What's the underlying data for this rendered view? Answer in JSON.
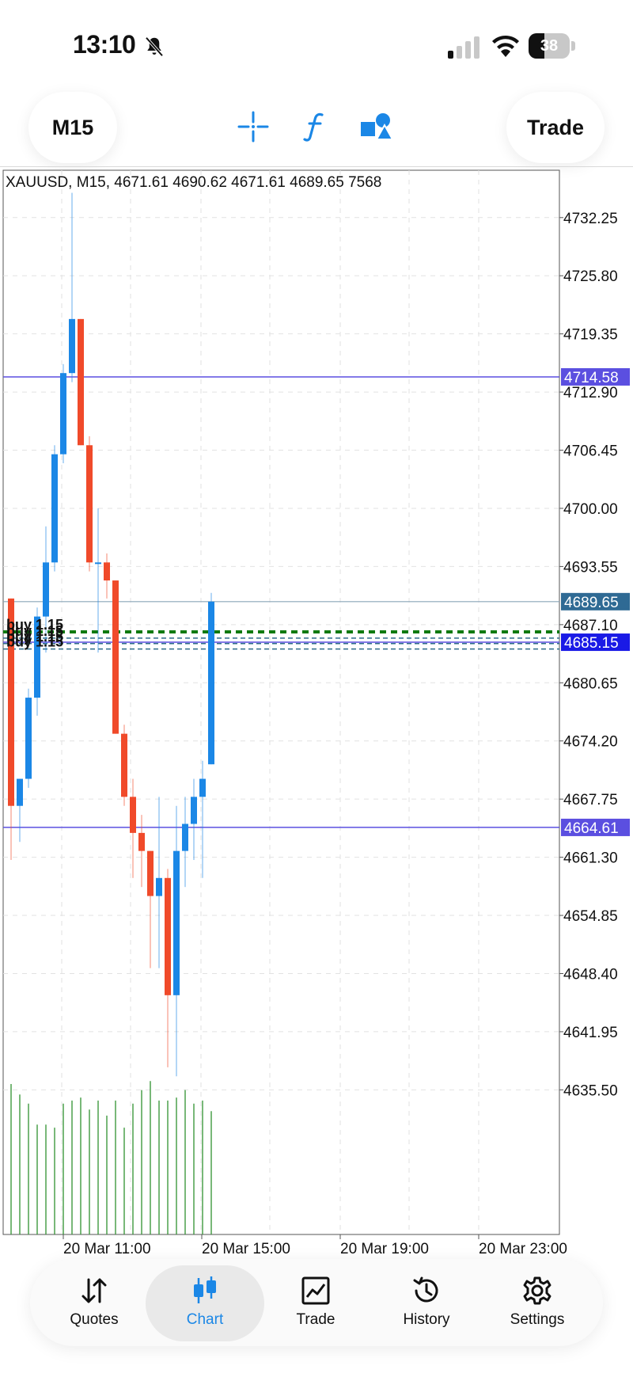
{
  "status": {
    "time": "13:10",
    "battery": "38",
    "battery_level": 0.38,
    "icons": [
      "bell-slash-icon",
      "cellular-signal-icon",
      "wifi-icon",
      "battery-icon"
    ]
  },
  "toolbar": {
    "timeframe": "M15",
    "trade_label": "Trade",
    "icons": [
      "crosshair-icon",
      "indicator-f-icon",
      "objects-shapes-icon"
    ]
  },
  "chart": {
    "header": "XAUUSD, M15, 4671.61 4690.62 4671.61 4689.65 7568",
    "price_labels": [
      "4732.25",
      "4725.80",
      "4719.35",
      "4712.90",
      "4706.45",
      "4700.00",
      "4693.55",
      "4687.10",
      "4680.65",
      "4674.20",
      "4667.75",
      "4661.30",
      "4654.85",
      "4648.40",
      "4641.95",
      "4635.50"
    ],
    "time_labels": [
      "20 Mar 11:00",
      "20 Mar 15:00",
      "20 Mar 19:00",
      "20 Mar 23:00"
    ],
    "price_tags": [
      {
        "value": "4714.58",
        "color": "#5b4fe0"
      },
      {
        "value": "4689.65",
        "color": "#2f6a94"
      },
      {
        "value": "4685.15",
        "color": "#1a1ae6"
      },
      {
        "value": "4664.61",
        "color": "#5b4fe0"
      }
    ],
    "order_labels": [
      "buy 1.15",
      "buy 1.15",
      "buy 1.15",
      "buy 1.15"
    ],
    "colors": {
      "bull": "#1b87e6",
      "bear": "#f04a2a",
      "volume": "#3f9a3f",
      "order_line": "#0f7a0f",
      "level_line": "#5b4fe0"
    }
  },
  "chart_data": {
    "type": "candlestick",
    "symbol": "XAUUSD",
    "timeframe": "M15",
    "y_range": [
      4630,
      4737
    ],
    "levels": [
      4714.58,
      4685.15,
      4664.61
    ],
    "current_price": 4689.65,
    "order_prices": [
      4686.3,
      4685.6,
      4685.0,
      4684.4
    ],
    "candles": [
      {
        "o": 4690,
        "h": 4690,
        "l": 4661,
        "c": 4667
      },
      {
        "o": 4667,
        "h": 4670,
        "l": 4663,
        "c": 4670
      },
      {
        "o": 4670,
        "h": 4680,
        "l": 4669,
        "c": 4679
      },
      {
        "o": 4679,
        "h": 4689,
        "l": 4677,
        "c": 4688
      },
      {
        "o": 4688,
        "h": 4698,
        "l": 4684,
        "c": 4694
      },
      {
        "o": 4694,
        "h": 4707,
        "l": 4693,
        "c": 4706
      },
      {
        "o": 4706,
        "h": 4716,
        "l": 4705,
        "c": 4715
      },
      {
        "o": 4715,
        "h": 4735,
        "l": 4714,
        "c": 4721
      },
      {
        "o": 4721,
        "h": 4721,
        "l": 4707,
        "c": 4707
      },
      {
        "o": 4707,
        "h": 4708,
        "l": 4693,
        "c": 4694
      },
      {
        "o": 4694,
        "h": 4700,
        "l": 4684,
        "c": 4694
      },
      {
        "o": 4694,
        "h": 4695,
        "l": 4690,
        "c": 4692
      },
      {
        "o": 4692,
        "h": 4692,
        "l": 4675,
        "c": 4675
      },
      {
        "o": 4675,
        "h": 4676,
        "l": 4667,
        "c": 4668
      },
      {
        "o": 4668,
        "h": 4670,
        "l": 4659,
        "c": 4664
      },
      {
        "o": 4664,
        "h": 4666,
        "l": 4658,
        "c": 4662
      },
      {
        "o": 4662,
        "h": 4662,
        "l": 4649,
        "c": 4657
      },
      {
        "o": 4657,
        "h": 4668,
        "l": 4649,
        "c": 4659
      },
      {
        "o": 4659,
        "h": 4660,
        "l": 4638,
        "c": 4646
      },
      {
        "o": 4646,
        "h": 4667,
        "l": 4637,
        "c": 4662
      },
      {
        "o": 4662,
        "h": 4668,
        "l": 4658,
        "c": 4665
      },
      {
        "o": 4665,
        "h": 4670,
        "l": 4661,
        "c": 4668
      },
      {
        "o": 4668,
        "h": 4672,
        "l": 4659,
        "c": 4670
      },
      {
        "o": 4671.61,
        "h": 4690.62,
        "l": 4671.61,
        "c": 4689.65
      }
    ],
    "volumes": [
      1.0,
      0.93,
      0.87,
      0.73,
      0.73,
      0.71,
      0.87,
      0.89,
      0.91,
      0.83,
      0.89,
      0.79,
      0.89,
      0.71,
      0.87,
      0.96,
      1.02,
      0.89,
      0.89,
      0.91,
      0.96,
      0.87,
      0.89,
      0.82
    ]
  },
  "nav": {
    "items": [
      {
        "label": "Quotes",
        "name": "nav-quotes",
        "active": false
      },
      {
        "label": "Chart",
        "name": "nav-chart",
        "active": true
      },
      {
        "label": "Trade",
        "name": "nav-trade",
        "active": false
      },
      {
        "label": "History",
        "name": "nav-history",
        "active": false
      },
      {
        "label": "Settings",
        "name": "nav-settings",
        "active": false
      }
    ]
  }
}
